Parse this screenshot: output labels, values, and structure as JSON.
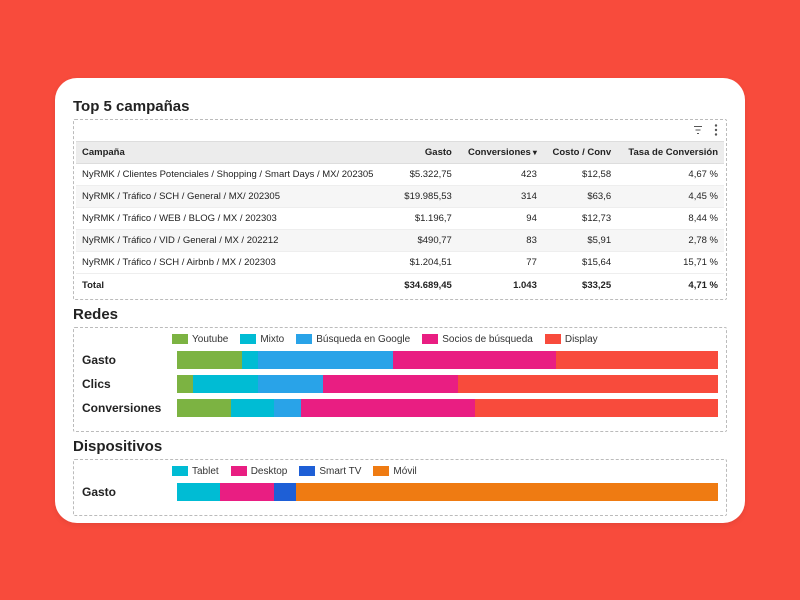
{
  "sections": {
    "campaigns": {
      "title": "Top 5 campañas"
    },
    "networks": {
      "title": "Redes"
    },
    "devices": {
      "title": "Dispositivos"
    }
  },
  "table": {
    "headers": {
      "campaign": "Campaña",
      "spend": "Gasto",
      "conversions": "Conversiones",
      "costconv": "Costo / Conv",
      "convrate": "Tasa de Conversión"
    },
    "rows": [
      {
        "campaign": "NyRMK / Clientes Potenciales / Shopping / Smart Days / MX/ 202305",
        "spend": "$5.322,75",
        "conversions": "423",
        "costconv": "$12,58",
        "convrate": "4,67 %"
      },
      {
        "campaign": "NyRMK / Tráfico / SCH / General / MX/ 202305",
        "spend": "$19.985,53",
        "conversions": "314",
        "costconv": "$63,6",
        "convrate": "4,45 %"
      },
      {
        "campaign": "NyRMK / Tráfico / WEB / BLOG / MX / 202303",
        "spend": "$1.196,7",
        "conversions": "94",
        "costconv": "$12,73",
        "convrate": "8,44 %"
      },
      {
        "campaign": "NyRMK / Tráfico / VID / General / MX / 202212",
        "spend": "$490,77",
        "conversions": "83",
        "costconv": "$5,91",
        "convrate": "2,78 %"
      },
      {
        "campaign": "NyRMK / Tráfico / SCH / Airbnb / MX / 202303",
        "spend": "$1.204,51",
        "conversions": "77",
        "costconv": "$15,64",
        "convrate": "15,71 %"
      }
    ],
    "total": {
      "label": "Total",
      "spend": "$34.689,45",
      "conversions": "1.043",
      "costconv": "$33,25",
      "convrate": "4,71 %"
    }
  },
  "networks_legend": [
    {
      "name": "Youtube",
      "cls": "c-youtube"
    },
    {
      "name": "Mixto",
      "cls": "c-mixto"
    },
    {
      "name": "Búsqueda en Google",
      "cls": "c-google"
    },
    {
      "name": "Socios de búsqueda",
      "cls": "c-socios"
    },
    {
      "name": "Display",
      "cls": "c-display"
    }
  ],
  "networks_rows": [
    {
      "label": "Gasto",
      "key": "gasto"
    },
    {
      "label": "Clics",
      "key": "clics"
    },
    {
      "label": "Conversiones",
      "key": "conv"
    }
  ],
  "devices_legend": [
    {
      "name": "Tablet",
      "cls": "c-tablet"
    },
    {
      "name": "Desktop",
      "cls": "c-desktop"
    },
    {
      "name": "Smart TV",
      "cls": "c-smarttv"
    },
    {
      "name": "Móvil",
      "cls": "c-movil"
    }
  ],
  "devices_rows": [
    {
      "label": "Gasto",
      "key": "gasto"
    }
  ],
  "chart_data": [
    {
      "type": "bar",
      "orientation": "horizontal-stacked",
      "title": "Redes",
      "categories": [
        "Gasto",
        "Clics",
        "Conversiones"
      ],
      "series": [
        {
          "name": "Youtube",
          "values": [
            12,
            3,
            10
          ]
        },
        {
          "name": "Mixto",
          "values": [
            3,
            12,
            8
          ]
        },
        {
          "name": "Búsqueda en Google",
          "values": [
            25,
            12,
            5
          ]
        },
        {
          "name": "Socios de búsqueda",
          "values": [
            30,
            25,
            32
          ]
        },
        {
          "name": "Display",
          "values": [
            30,
            48,
            45
          ]
        }
      ],
      "unit": "percent",
      "note": "values are approximate share of each stacked bar, read from pixel widths"
    },
    {
      "type": "bar",
      "orientation": "horizontal-stacked",
      "title": "Dispositivos",
      "categories": [
        "Gasto"
      ],
      "series": [
        {
          "name": "Tablet",
          "values": [
            8
          ]
        },
        {
          "name": "Desktop",
          "values": [
            10
          ]
        },
        {
          "name": "Smart TV",
          "values": [
            4
          ]
        },
        {
          "name": "Móvil",
          "values": [
            78
          ]
        }
      ],
      "unit": "percent",
      "note": "values are approximate share of stacked bar"
    }
  ]
}
